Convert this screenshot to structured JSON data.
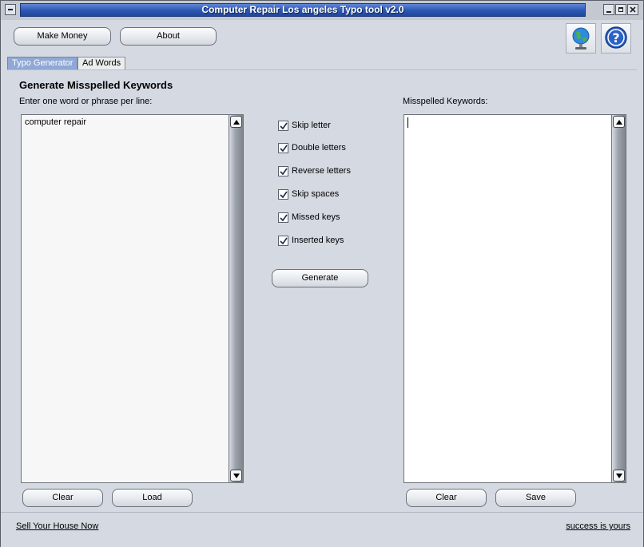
{
  "window": {
    "title": "Computer Repair Los angeles Typo tool v2.0"
  },
  "toolbar": {
    "make_money_label": "Make Money",
    "about_label": "About",
    "globe_icon": "globe-icon",
    "help_icon": "help-icon"
  },
  "tabs": [
    {
      "label": "Typo Generator",
      "active": true
    },
    {
      "label": "Ad Words",
      "active": false
    }
  ],
  "main": {
    "heading": "Generate Misspelled Keywords",
    "input_label": "Enter one word or phrase per line:",
    "input_value": "computer repair",
    "output_label": "Misspelled Keywords:",
    "output_value": "",
    "options": [
      {
        "label": "Skip letter",
        "checked": true
      },
      {
        "label": "Double letters",
        "checked": true
      },
      {
        "label": "Reverse letters",
        "checked": true
      },
      {
        "label": "Skip spaces",
        "checked": true
      },
      {
        "label": "Missed keys",
        "checked": true
      },
      {
        "label": "Inserted keys",
        "checked": true
      }
    ],
    "generate_label": "Generate",
    "left_clear_label": "Clear",
    "load_label": "Load",
    "right_clear_label": "Clear",
    "save_label": "Save"
  },
  "footer": {
    "left_link": "Sell Your House Now",
    "right_link": "success is yours"
  },
  "colors": {
    "title_bar": "#2c56b3",
    "window_bg": "#d5d9e2",
    "active_tab": "#8fa8d6"
  }
}
